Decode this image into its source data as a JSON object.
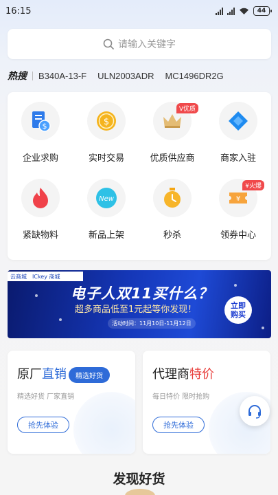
{
  "status_bar": {
    "time": "16:15",
    "battery": "44"
  },
  "search": {
    "placeholder": "请输入关键字"
  },
  "hot": {
    "title": "热搜",
    "keywords": [
      "B340A-13-F",
      "ULN2003ADR",
      "MC1496DR2G"
    ]
  },
  "categories": [
    {
      "label": "企业求购",
      "icon": "invoice-dollar-icon"
    },
    {
      "label": "实时交易",
      "icon": "gold-coin-icon"
    },
    {
      "label": "优质供应商",
      "icon": "crown-icon",
      "tag": "V优质"
    },
    {
      "label": "商家入驻",
      "icon": "blue-diamond-icon"
    },
    {
      "label": "紧缺物料",
      "icon": "flame-icon"
    },
    {
      "label": "新品上架",
      "icon": "new-badge-icon"
    },
    {
      "label": "秒杀",
      "icon": "stopwatch-icon"
    },
    {
      "label": "领券中心",
      "icon": "coupon-icon",
      "tag": "¥火爆"
    }
  ],
  "banner": {
    "logo_a": "云商城",
    "logo_b": "ICkey 商城",
    "title": "电子人双11买什么？",
    "subtitle": "超多商品低至1元起等你发现！",
    "date": "活动时间：11月10日-11月12日",
    "button": "立即购买"
  },
  "promo_left": {
    "title_plain": "原厂",
    "title_highlight": "直销",
    "pill": "精选好货",
    "subtitle": "精选好货 厂家直销",
    "button": "抢先体验"
  },
  "promo_right": {
    "title_plain": "代理商",
    "title_highlight": "特价",
    "subtitle": "每日特价  限时抢购",
    "button": "抢先体验"
  },
  "section": {
    "title": "发现好货"
  },
  "colors": {
    "accent_blue": "#2e6bd8",
    "accent_red": "#e8413e",
    "tag_red": "#f0494b"
  }
}
